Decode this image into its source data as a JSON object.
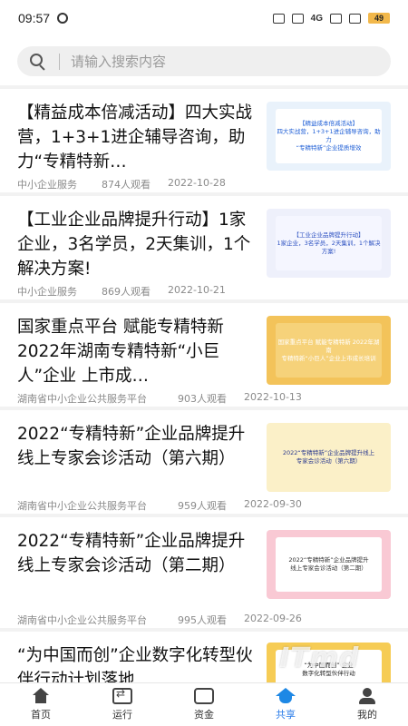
{
  "status_bar": {
    "time": "09:57",
    "network": "4G",
    "battery": "49"
  },
  "search": {
    "placeholder": "请输入搜索内容"
  },
  "articles": [
    {
      "title": "【精益成本倍减活动】四大实战营，1+3+1进企辅导咨询，助力“专精特新…",
      "source": "中小企业服务",
      "views": "874人观看",
      "date": "2022-10-28",
      "thumb": {
        "lines": [
          "【精益成本倍减活动】",
          "四大实战营，1+3+1进企辅导咨询，助力",
          "“专精特新”企业提质增效"
        ],
        "bg": "#e9f2fb",
        "panel": "#ffffff",
        "accent": "#1f5fd6"
      }
    },
    {
      "title": "【工业企业品牌提升行动】1家企业，3名学员，2天集训，1个解决方案!",
      "source": "中小企业服务",
      "views": "869人观看",
      "date": "2022-10-21",
      "thumb": {
        "lines": [
          "【工业企业品牌提升行动】",
          "1家企业，3名学员，2天集训，1个解决方案!"
        ],
        "bg": "#eef0fb",
        "panel": "#f5f6ff",
        "accent": "#2a4fc0"
      }
    },
    {
      "title": "国家重点平台 赋能专精特新 2022年湖南专精特新“小巨人”企业 上市成…",
      "source": "湖南省中小企业公共服务平台",
      "views": "903人观看",
      "date": "2022-10-13",
      "thumb": {
        "lines": [
          "国家重点平台 赋能专精特新 2022年湖南",
          "专精特新“小巨人”企业上市成长培训"
        ],
        "bg": "#f3c35a",
        "panel": "#f6d27a",
        "accent": "#ffffff"
      }
    },
    {
      "title": "2022“专精特新”企业品牌提升线上专家会诊活动（第六期）",
      "source": "湖南省中小企业公共服务平台",
      "views": "959人观看",
      "date": "2022-09-30",
      "thumb": {
        "lines": [
          "2022“专精特新”企业品牌提升线上",
          "专家会诊活动（第六期）"
        ],
        "bg": "#fbf0c8",
        "panel": "#fbf0c8",
        "accent": "#2b3a8f"
      }
    },
    {
      "title": "2022“专精特新”企业品牌提升线上专家会诊活动（第二期）",
      "source": "湖南省中小企业公共服务平台",
      "views": "995人观看",
      "date": "2022-09-26",
      "thumb": {
        "lines": [
          "2022“专精特新”企业品牌提升",
          "线上专家会诊活动（第二期）"
        ],
        "bg": "#f9c9d4",
        "panel": "#ffffff",
        "accent": "#333333"
      }
    },
    {
      "title": "“为中国而创”企业数字化转型伙伴行动计划落地",
      "source": "",
      "views": "",
      "date": "",
      "thumb": {
        "lines": [
          "“为中国而创” 企业",
          "数字化转型伙伴行动"
        ],
        "bg": "#f6cc55",
        "panel": "#ffffff",
        "accent": "#222222"
      }
    }
  ],
  "tabbar": {
    "tabs": [
      {
        "label": "首页",
        "icon": "home-icon",
        "active": false
      },
      {
        "label": "运行",
        "icon": "run-icon",
        "active": false
      },
      {
        "label": "资金",
        "icon": "money-icon",
        "active": false
      },
      {
        "label": "共享",
        "icon": "share-icon",
        "active": true
      },
      {
        "label": "我的",
        "icon": "profile-icon",
        "active": false
      }
    ]
  }
}
